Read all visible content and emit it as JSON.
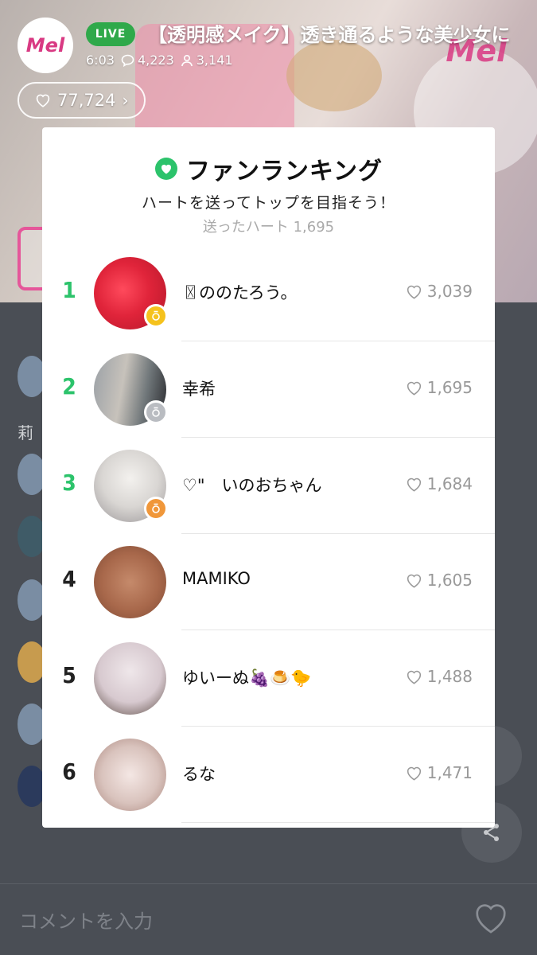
{
  "broadcast": {
    "channel_logo": "Mel",
    "live_badge": "LIVE",
    "title": "【透明感メイク】透き通るような美少女に",
    "elapsed": "6:03",
    "comments": "4,223",
    "viewers": "3,141",
    "hearts_total": "77,724",
    "watermark": "Mel"
  },
  "chat": {
    "visible_char": "莉"
  },
  "comment_bar": {
    "placeholder": "コメントを入力"
  },
  "ranking": {
    "title": "ファンランキング",
    "subtitle": "ハートを送ってトップを目指そう！",
    "sent_label": "送ったハート 1,695",
    "items": [
      {
        "rank": "1",
        "name": "〿ののたろう。",
        "hearts": "3,039",
        "medal": "gold"
      },
      {
        "rank": "2",
        "name": "幸希",
        "hearts": "1,695",
        "medal": "silver"
      },
      {
        "rank": "3",
        "name": "♡\"　いのおちゃん",
        "hearts": "1,684",
        "medal": "bronze"
      },
      {
        "rank": "4",
        "name": "MAMIKO",
        "hearts": "1,605",
        "medal": ""
      },
      {
        "rank": "5",
        "name": "ゆいーぬ🍇🍮🐤",
        "hearts": "1,488",
        "medal": ""
      },
      {
        "rank": "6",
        "name": "るな",
        "hearts": "1,471",
        "medal": ""
      }
    ]
  },
  "colors": {
    "accent_green": "#2cc36b",
    "live_green": "#2fa94a",
    "brand_pink": "#d93a83",
    "gold": "#f5c21d",
    "silver": "#b9bcc1",
    "bronze": "#f0973a"
  }
}
